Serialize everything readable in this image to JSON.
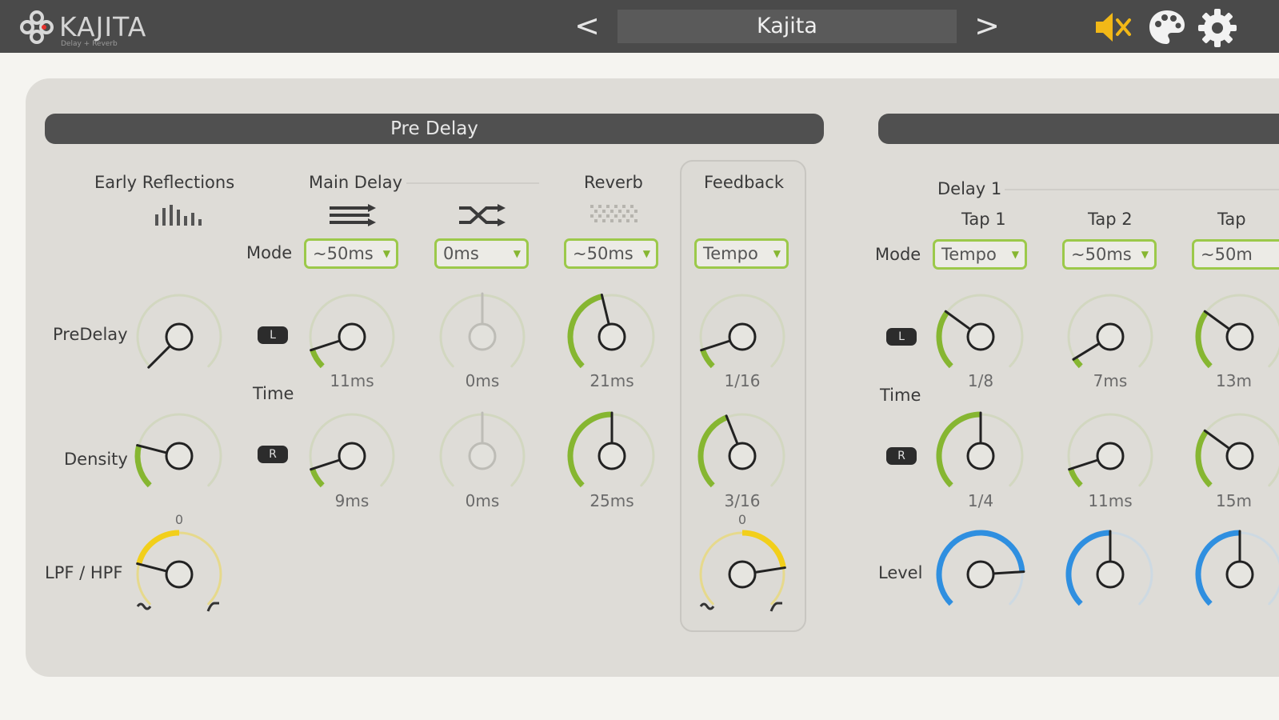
{
  "header": {
    "logo_text": "KAJITA",
    "logo_subtitle": "Delay + Reverb",
    "prev_label": "<",
    "next_label": ">",
    "preset_name": "Kajita",
    "icons": [
      "speaker-mute-icon",
      "palette-icon",
      "gear-icon"
    ],
    "colors": {
      "mute": "#f2b817",
      "bar": "#4a4a4a"
    }
  },
  "predelay": {
    "title": "Pre Delay",
    "columns": {
      "early_reflections": "Early Reflections",
      "main_delay": "Main Delay",
      "reverb": "Reverb",
      "feedback": "Feedback"
    },
    "row_labels": {
      "mode": "Mode",
      "predelay": "PreDelay",
      "time": "Time",
      "density": "Density",
      "lpf_hpf": "LPF / HPF"
    },
    "lr": {
      "left": "L",
      "right": "R"
    },
    "modes": {
      "main1": "~50ms",
      "main2": "0ms",
      "reverb": "~50ms",
      "feedback": "Tempo"
    },
    "values": {
      "main1_l": "11ms",
      "main1_r": "9ms",
      "main2_l": "0ms",
      "main2_r": "0ms",
      "reverb_l": "21ms",
      "reverb_r": "25ms",
      "feedback_l": "1/16",
      "feedback_r": "3/16"
    },
    "filter_center": "0",
    "filter_center_fb": "0"
  },
  "delay": {
    "title": "",
    "group_label": "Delay 1",
    "taps": [
      "Tap 1",
      "Tap 2",
      "Tap"
    ],
    "row_labels": {
      "mode": "Mode",
      "time": "Time",
      "level": "Level"
    },
    "lr": {
      "left": "L",
      "right": "R"
    },
    "modes": [
      "Tempo",
      "~50ms",
      "~50m"
    ],
    "values_l": [
      "1/8",
      "7ms",
      "13m"
    ],
    "values_r": [
      "1/4",
      "11ms",
      "15m"
    ]
  },
  "colors": {
    "accent_green": "#86b631",
    "accent_blue": "#2f8fe0",
    "accent_yellow": "#f2cf1b",
    "panel": "#dedcd7"
  }
}
